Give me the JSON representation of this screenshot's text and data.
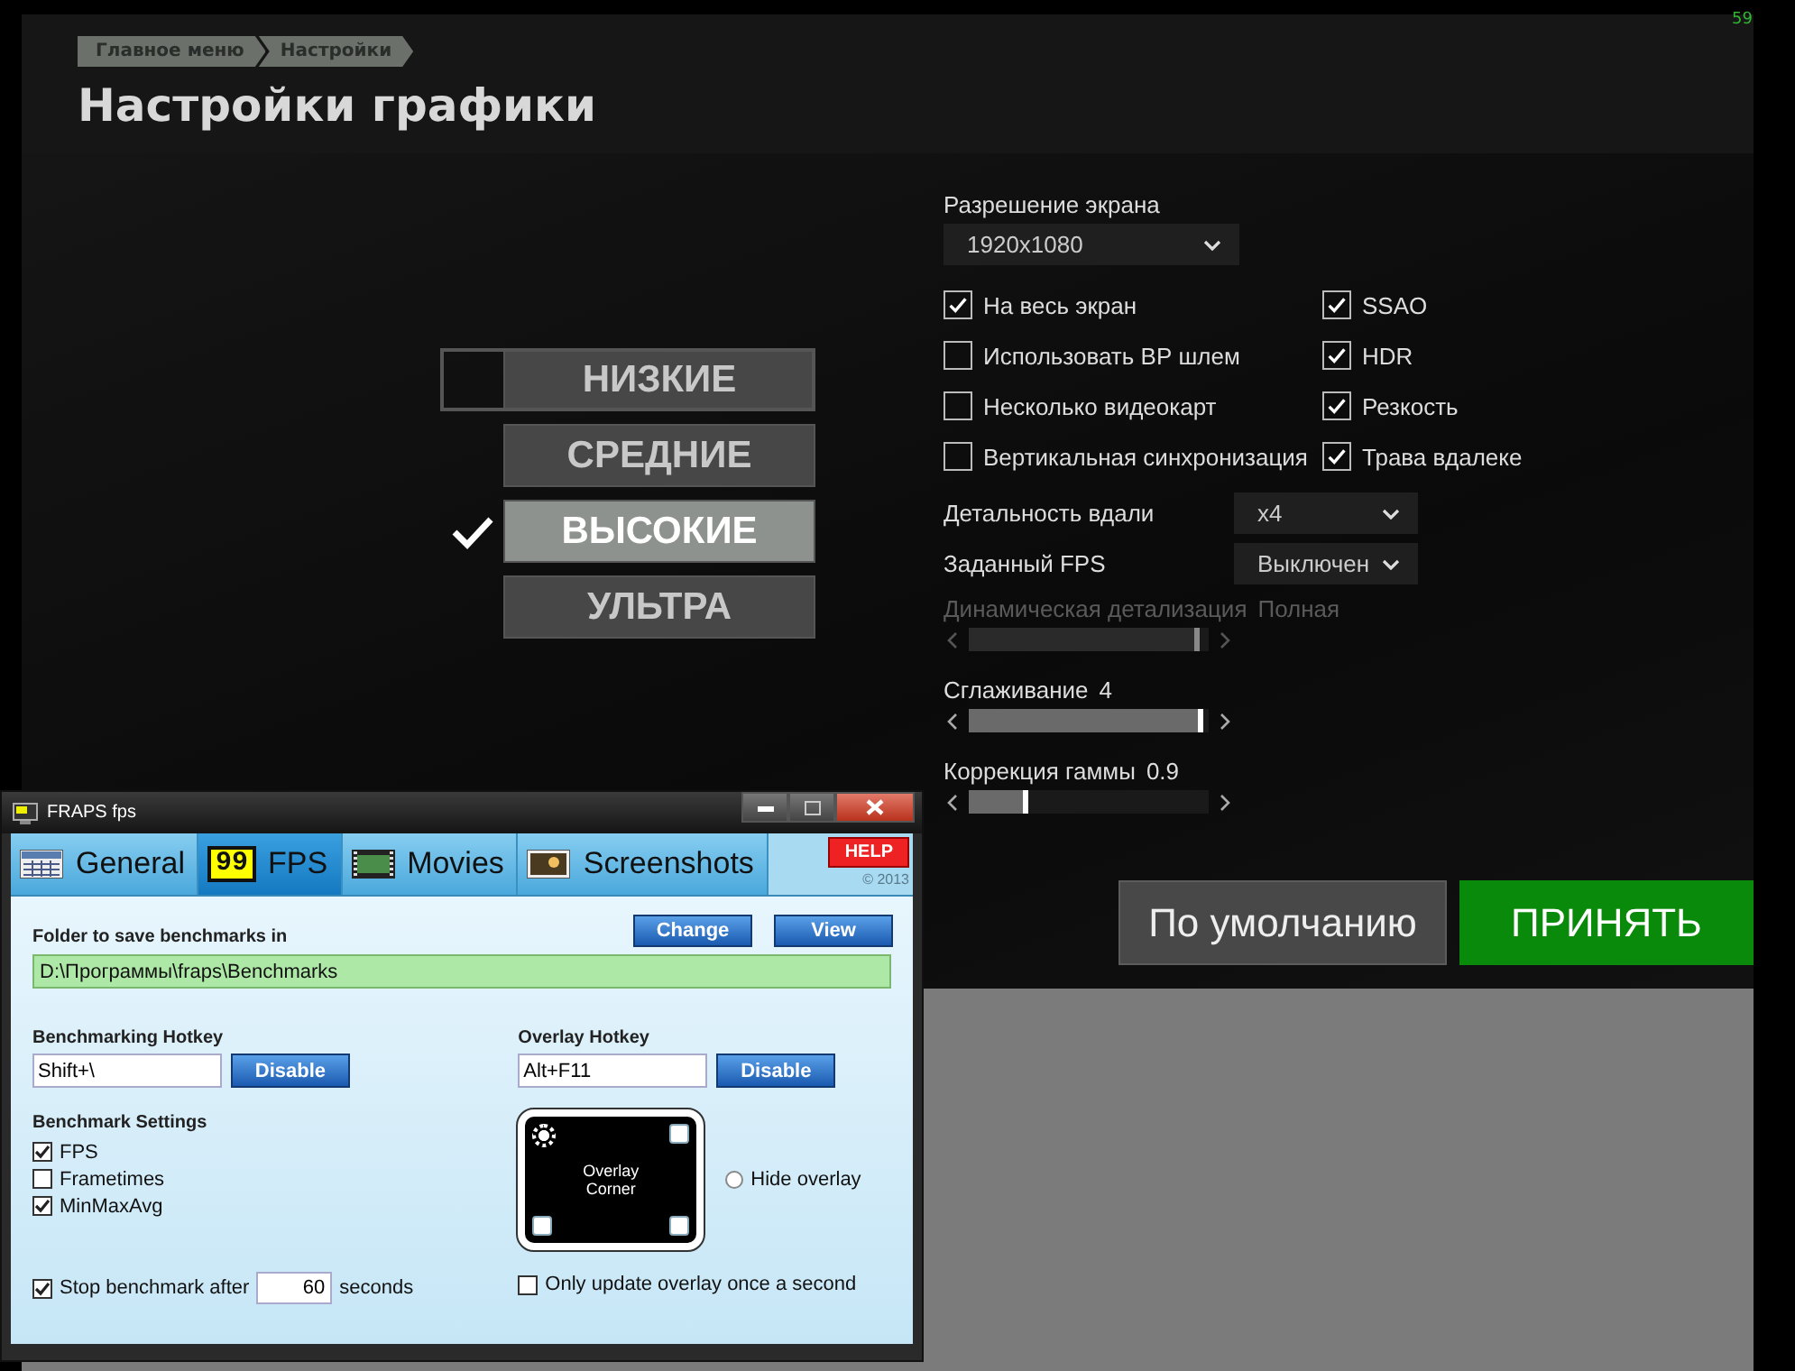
{
  "game": {
    "fps_counter": "59",
    "breadcrumb": [
      "Главное меню",
      "Настройки"
    ],
    "title": "Настройки графики",
    "presets": [
      {
        "label": "НИЗКИЕ",
        "selected": false,
        "focused": true
      },
      {
        "label": "СРЕДНИЕ",
        "selected": false,
        "focused": false
      },
      {
        "label": "ВЫСОКИЕ",
        "selected": true,
        "focused": false
      },
      {
        "label": "УЛЬТРА",
        "selected": false,
        "focused": false
      }
    ],
    "resolution": {
      "label": "Разрешение экрана",
      "value": "1920x1080"
    },
    "checkbox_columns": [
      [
        {
          "label": "На весь экран",
          "checked": true
        },
        {
          "label": "Использовать ВР шлем",
          "checked": false
        },
        {
          "label": "Несколько видеокарт",
          "checked": false
        },
        {
          "label": "Вертикальная синхронизация",
          "checked": false
        }
      ],
      [
        {
          "label": "SSAO",
          "checked": true
        },
        {
          "label": "HDR",
          "checked": true
        },
        {
          "label": "Резкость",
          "checked": true
        },
        {
          "label": "Трава вдалеке",
          "checked": true
        }
      ]
    ],
    "selects": [
      {
        "label": "Детальность вдали",
        "value": "x4"
      },
      {
        "label": "Заданный FPS",
        "value": "Выключен"
      }
    ],
    "sliders": [
      {
        "label": "Динамическая детализация",
        "reading": "Полная",
        "level": 0.96,
        "disabled": true
      },
      {
        "label": "Сглаживание",
        "reading": "4",
        "level": 0.98,
        "disabled": false
      },
      {
        "label": "Коррекция гаммы",
        "reading": "0.9",
        "level": 0.25,
        "disabled": false
      }
    ],
    "buttons": [
      {
        "label": "По умолчанию",
        "kind": "secondary"
      },
      {
        "label": "ПРИНЯТЬ",
        "kind": "primary"
      }
    ]
  },
  "fraps": {
    "title": "FRAPS fps",
    "tabs": [
      {
        "label": "General",
        "selected": false
      },
      {
        "label": "FPS",
        "badge": "99",
        "selected": true
      },
      {
        "label": "Movies",
        "selected": false
      },
      {
        "label": "Screenshots",
        "selected": false
      }
    ],
    "help": "HELP",
    "copyright": "© 2013",
    "folder": {
      "label": "Folder to save benchmarks in",
      "value": "D:\\Программы\\fraps\\Benchmarks",
      "buttons": [
        "Change",
        "View"
      ]
    },
    "benchmark_hotkey": {
      "label": "Benchmarking Hotkey",
      "value": "Shift+\\",
      "button": "Disable"
    },
    "overlay_hotkey": {
      "label": "Overlay Hotkey",
      "value": "Alt+F11",
      "button": "Disable"
    },
    "settings": {
      "title": "Benchmark Settings",
      "options": [
        {
          "label": "FPS",
          "checked": true
        },
        {
          "label": "Frametimes",
          "checked": false
        },
        {
          "label": "MinMaxAvg",
          "checked": true
        }
      ]
    },
    "overlay_corner": {
      "label": "Overlay Corner",
      "corners": [
        {
          "selected": true
        },
        {
          "selected": false
        },
        {
          "selected": false
        },
        {
          "selected": false
        }
      ]
    },
    "hide_overlay": {
      "label": "Hide overlay",
      "selected": false
    },
    "stop_after": {
      "label": "Stop benchmark after",
      "checked": true,
      "value": "60",
      "unit": "seconds"
    },
    "update_once": {
      "label": "Only update overlay once a second",
      "checked": false
    }
  }
}
